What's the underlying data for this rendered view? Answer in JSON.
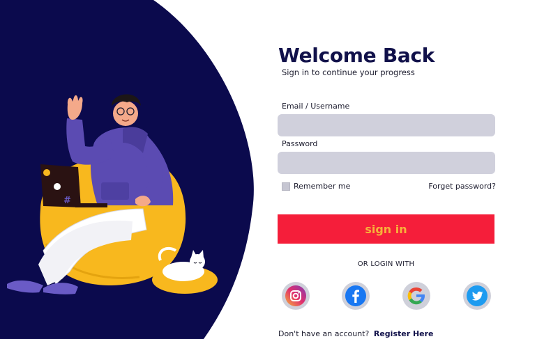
{
  "login": {
    "title": "Welcome Back",
    "subtitle": "Sign in to continue your progress",
    "email_label": "Email / Username",
    "email_value": "",
    "password_label": "Password",
    "password_value": "",
    "remember_label": "Remember me",
    "remember_checked": false,
    "forgot_label": "Forget password?",
    "signin_label": "sign in",
    "or_label": "OR LOGIN WITH",
    "social": [
      "instagram-icon",
      "facebook-icon",
      "google-icon",
      "twitter-icon"
    ],
    "register_prompt": "Don't have an account?",
    "register_link": "Register Here"
  },
  "colors": {
    "navy": "#0b0a4d",
    "brand_red": "#f51e3a",
    "button_text": "#f7b23a",
    "field_bg": "#d0d0dc",
    "beanbag": "#f8b81e",
    "hoodie": "#5b4bb2"
  }
}
